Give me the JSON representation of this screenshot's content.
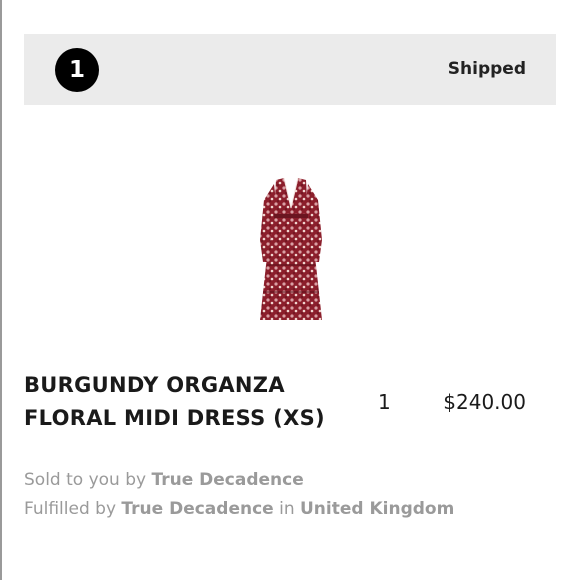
{
  "shipment": {
    "number": "1",
    "status": "Shipped"
  },
  "item": {
    "image_alt_icon": "dress-image",
    "name": "BURGUNDY ORGANZA FLORAL MIDI DRESS (XS)",
    "quantity": "1",
    "price": "$240.00"
  },
  "seller": {
    "sold_prefix": "Sold to you by",
    "sold_by": "True Decadence",
    "fulfilled_prefix": "Fulfilled by",
    "fulfilled_by": "True Decadence",
    "in_word": "in",
    "country": "United Kingdom"
  },
  "colors": {
    "header_bg": "#ebebeb",
    "badge_bg": "#000000",
    "muted_text": "#9a9a9a",
    "dress_primary": "#8b1e2b"
  }
}
